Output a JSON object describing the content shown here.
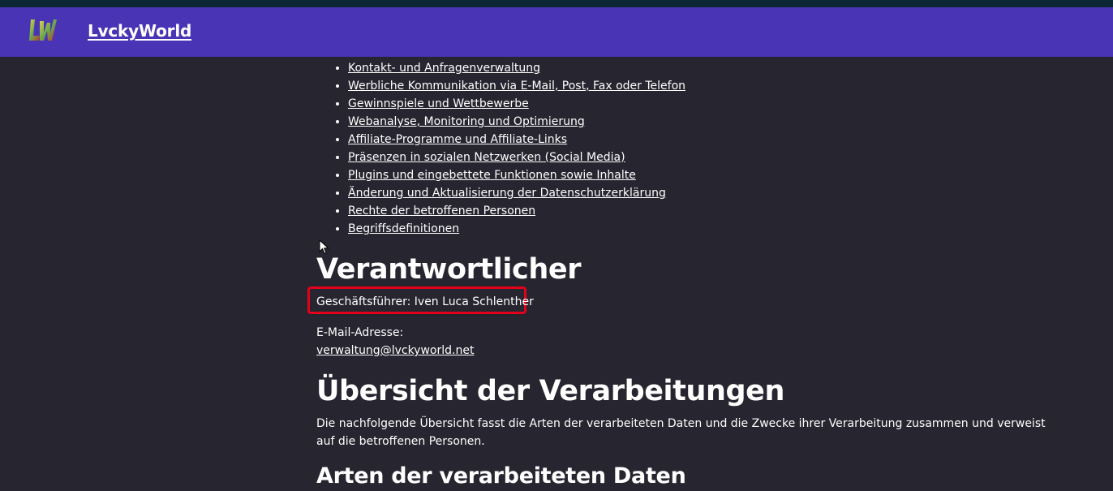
{
  "brand": {
    "name": "LvckyWorld",
    "logo_text": "LW"
  },
  "toc": {
    "items": [
      "Kontakt- und Anfragenverwaltung",
      "Werbliche Kommunikation via E-Mail, Post, Fax oder Telefon",
      "Gewinnspiele und Wettbewerbe",
      "Webanalyse, Monitoring und Optimierung",
      "Affiliate-Programme und Affiliate-Links",
      "Präsenzen in sozialen Netzwerken (Social Media)",
      "Plugins und eingebettete Funktionen sowie Inhalte",
      "Änderung und Aktualisierung der Datenschutzerklärung",
      "Rechte der betroffenen Personen",
      "Begriffsdefinitionen"
    ]
  },
  "responsible": {
    "heading": "Verantwortlicher",
    "manager": "Geschäftsführer: Iven Luca Schlenther",
    "email_label": "E-Mail-Adresse:",
    "email": "verwaltung@lvckyworld.net"
  },
  "overview": {
    "heading": "Übersicht der Verarbeitungen",
    "text": "Die nachfolgende Übersicht fasst die Arten der verarbeiteten Daten und die Zwecke ihrer Verarbeitung zusammen und verweist auf die betroffenen Personen."
  },
  "data_types": {
    "heading": "Arten der verarbeiteten Daten"
  },
  "colors": {
    "navbar": "#4834b5",
    "background": "#27252f",
    "highlight": "#e3001b"
  }
}
